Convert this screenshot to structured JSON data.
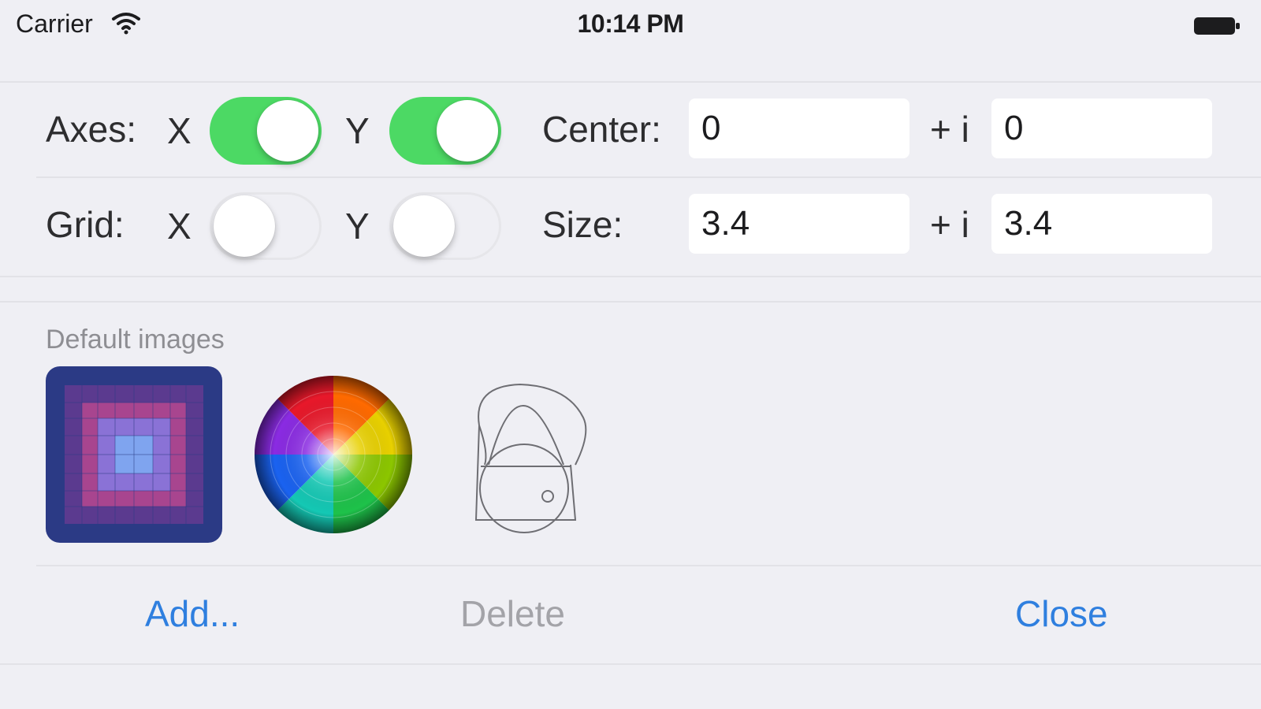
{
  "status_bar": {
    "carrier": "Carrier",
    "time": "10:14 PM",
    "wifi_icon": "wifi-icon",
    "battery_icon": "battery-icon"
  },
  "axes_row": {
    "label": "Axes:",
    "x_label": "X",
    "y_label": "Y",
    "x_on": true,
    "y_on": true,
    "field_label": "Center:",
    "plus_i": "+ i",
    "real_value": "0",
    "imag_value": "0"
  },
  "grid_row": {
    "label": "Grid:",
    "x_label": "X",
    "y_label": "Y",
    "x_on": false,
    "y_on": false,
    "field_label": "Size:",
    "plus_i": "+ i",
    "real_value": "3.4",
    "imag_value": "3.4"
  },
  "images": {
    "header": "Default images",
    "items": [
      "grid-pattern-thumbnail",
      "color-wheel-thumbnail",
      "line-drawing-thumbnail"
    ]
  },
  "actions": {
    "add": "Add...",
    "delete": "Delete",
    "close": "Close"
  },
  "colors": {
    "toggle_on": "#4cd964",
    "link_blue": "#2f7fdf",
    "disabled_gray": "#a3a3a8",
    "background": "#efeff4"
  }
}
